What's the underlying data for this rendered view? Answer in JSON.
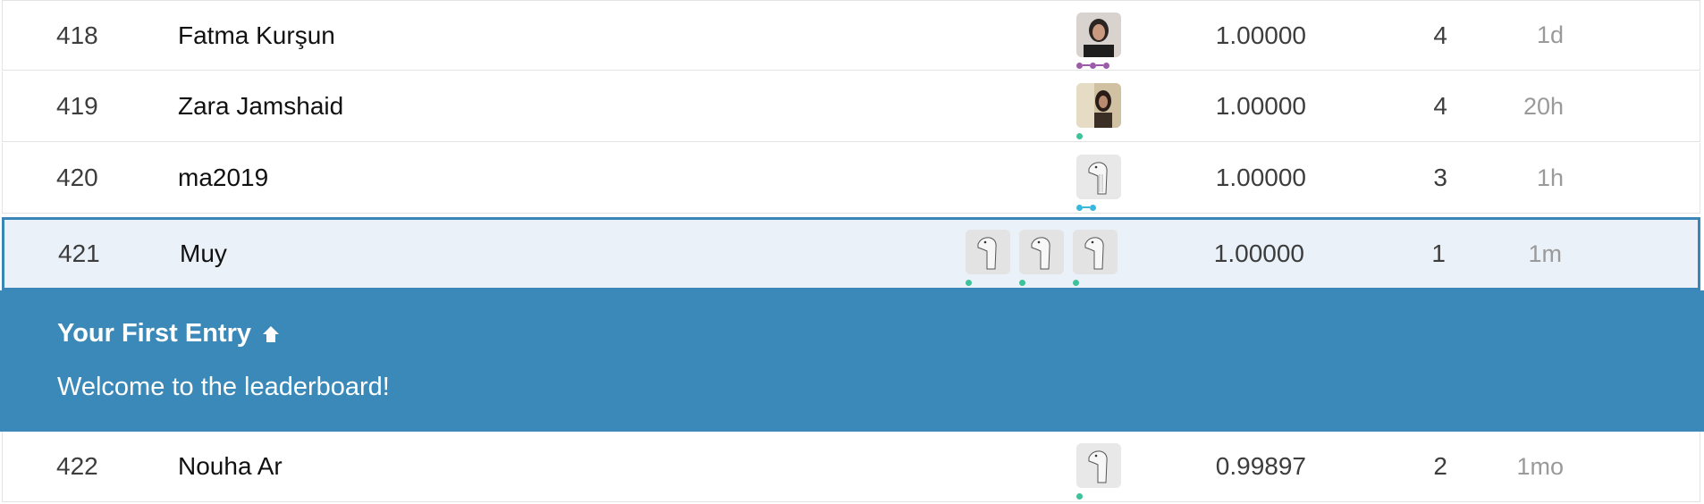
{
  "rows": [
    {
      "rank": "418",
      "name": "Fatma Kurşun",
      "score": "1.00000",
      "entries": "4",
      "last": "1d"
    },
    {
      "rank": "419",
      "name": "Zara Jamshaid",
      "score": "1.00000",
      "entries": "4",
      "last": "20h"
    },
    {
      "rank": "420",
      "name": "ma2019",
      "score": "1.00000",
      "entries": "3",
      "last": "1h"
    },
    {
      "rank": "421",
      "name": "Muy",
      "score": "1.00000",
      "entries": "1",
      "last": "1m"
    },
    {
      "rank": "422",
      "name": "Nouha Ar",
      "score": "0.99897",
      "entries": "2",
      "last": "1mo"
    }
  ],
  "banner": {
    "title": "Your First Entry",
    "title_icon": "arrow-up-icon",
    "message": "Welcome to the leaderboard!"
  },
  "colors": {
    "highlight_bg": "#eaf1f8",
    "highlight_border": "#3a86b8",
    "banner_bg": "#3b89b8",
    "tier_purple": "#9b5ba8",
    "tier_green": "#3ec29a",
    "tier_blue": "#3ab7dc"
  },
  "icons": {
    "default_avatar": "goose-avatar-icon"
  }
}
